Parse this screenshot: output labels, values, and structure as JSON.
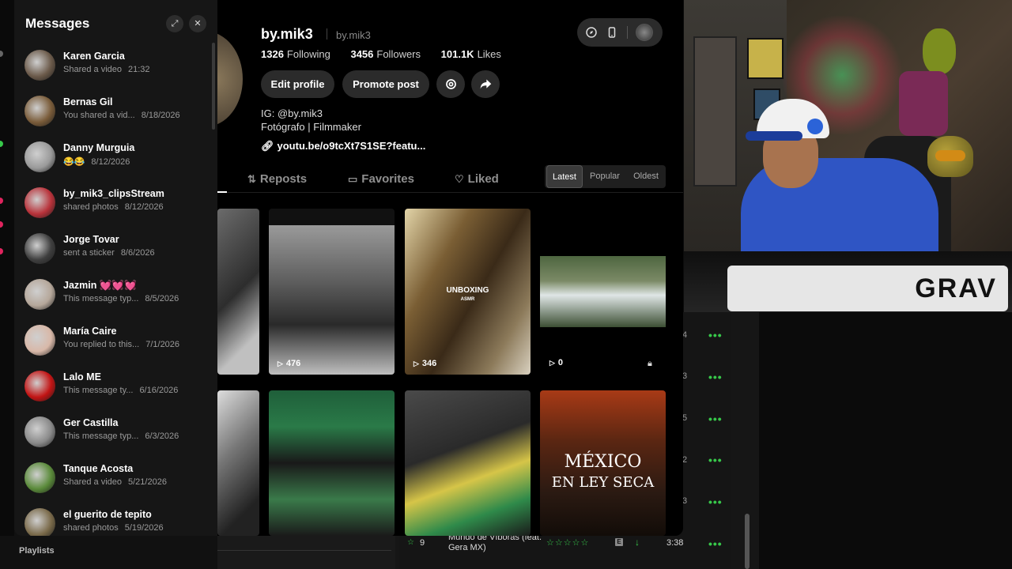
{
  "background_app": {
    "playlists_label": "Playlists",
    "track": {
      "number": "9",
      "title": "Mundo de Víboras (feat. Gera MX)",
      "rating": "☆☆☆☆☆",
      "explicit": "E",
      "duration": "3:38"
    },
    "row_numbers_partial": [
      "4",
      "3",
      "5",
      "2",
      "3"
    ],
    "accent_color": "#37c84a"
  },
  "profile": {
    "display_name": "by.mik3",
    "username": "by.mik3",
    "following_count": "1326",
    "following_label": "Following",
    "followers_count": "3456",
    "followers_label": "Followers",
    "likes_count": "101.1K",
    "likes_label": "Likes",
    "edit_button": "Edit profile",
    "promote_button": "Promote post",
    "bio_ig": "IG: @by.mik3",
    "bio_role": "Fotógrafo | Filmmaker",
    "link": "youtu.be/o9tcXt7S1SE?featu...",
    "tabs": {
      "reposts": "Reposts",
      "favorites": "Favorites",
      "liked": "Liked"
    },
    "sort": {
      "latest": "Latest",
      "popular": "Popular",
      "oldest": "Oldest",
      "selected": "Latest"
    },
    "videos": [
      {
        "views": ""
      },
      {
        "views": "476"
      },
      {
        "views": "346",
        "overlay_title": "UNBOXING",
        "overlay_sub": "ASMR"
      },
      {
        "views": "0",
        "locked": true
      },
      {
        "views": ""
      },
      {
        "views": ""
      },
      {
        "views": ""
      },
      {
        "views": "",
        "overlay_line1": "MÉXICO",
        "overlay_line2": "EN LEY SECA"
      }
    ]
  },
  "messages": {
    "title": "Messages",
    "items": [
      {
        "name": "Karen Garcia",
        "preview": "Shared a video",
        "time": "21:32",
        "avatar_color": "#6b5a4a"
      },
      {
        "name": "Bernas Gil",
        "preview": "You shared a vid...",
        "time": "8/18/2026",
        "avatar_color": "#7a5c3a"
      },
      {
        "name": "Danny Murguia",
        "preview": "😂😂",
        "time": "8/12/2026",
        "avatar_color": "#9a9a9a"
      },
      {
        "name": "by_mik3_clipsStream",
        "preview": "shared photos",
        "time": "8/12/2026",
        "avatar_color": "#b8323a"
      },
      {
        "name": "Jorge Tovar",
        "preview": "sent a sticker",
        "time": "8/6/2026",
        "avatar_color": "#3f3f3f"
      },
      {
        "name": "Jazmin 💓💓💓",
        "preview": "This message typ...",
        "time": "8/5/2026",
        "avatar_color": "#b5a79a"
      },
      {
        "name": "María Caire",
        "preview": "You replied to this...",
        "time": "7/1/2026",
        "avatar_color": "#d8b8a8"
      },
      {
        "name": "Lalo ME",
        "preview": "This message ty...",
        "time": "6/16/2026",
        "avatar_color": "#c21414"
      },
      {
        "name": "Ger Castilla",
        "preview": "This message typ...",
        "time": "6/3/2026",
        "avatar_color": "#8a8a8a"
      },
      {
        "name": "Tanque Acosta",
        "preview": "Shared a video",
        "time": "5/21/2026",
        "avatar_color": "#5a8a3a"
      },
      {
        "name": "el guerito de tepito",
        "preview": "shared photos",
        "time": "5/19/2026",
        "avatar_color": "#7a6a4a"
      }
    ]
  },
  "webcam": {
    "desk_logo_text": "GRAV"
  }
}
